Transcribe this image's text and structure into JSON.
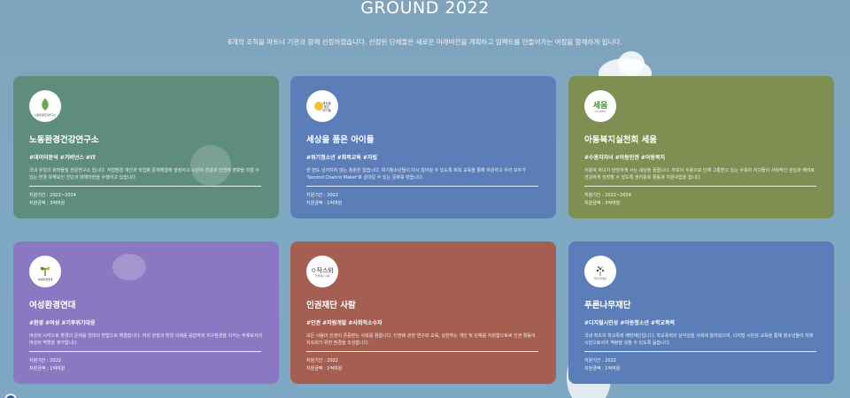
{
  "page": {
    "title": "GROUND 2022",
    "subtitle": "6개의 조직을 파트너 기관과 함께 선정하였습니다. 선정된 단체들은 새로운 미래비전을 계획하고 임팩트를 만들어가는 여정을 함께하게 됩니다."
  },
  "cards": [
    {
      "name": "노동환경건강연구소",
      "tags": "#데이터분석 #거버넌스 #IT",
      "desc": "국내 유일의 화학물질 전문연구소 입니다. 작업환경 개선과 직업병 문제해결에 앞장서고 시민의 건강과 안전에 영향을 미칠 수 있는 환경 유해요인 진단과 대책마련을 수행하고 있습니다.",
      "period": "지원기간 : 2022~2024",
      "amount": "지원금액 : 3억여원",
      "logo_text": "노동환경건강연구소",
      "bg": "#5f8d7b"
    },
    {
      "name": "세상을 품은 아이들",
      "tags": "#위기청소년 #회복교육 #자립",
      "desc": "한 번도 넘어지지 않는 청춘은 없습니다. 위기청소년들이 다시 일어설 수 있도록 회복 교육을 통해 자원하고 우리 모두가 'Second Chance Maker'로 살아갈 수 있는 문화를 만듭니다.",
      "period": "지원기간 : 2022",
      "amount": "지원금액 : 1억여원",
      "logo_text": "세상을 품은 아이들",
      "bg": "#5b7eb9"
    },
    {
      "name": "아동복지실천회 세움",
      "tags": "#수용자자녀 #아동인권 #아동복지",
      "desc": "수용자 자녀가 당당하게 사는 세상을 꿈꿉니다. 부모의 수용으로 인해 고통받고 있는 수용자 자녀들이 사회적인 관심과 배려로 건강하게 성장할 수 있도록 권리옹호 활동과 지원사업을 합니다.",
      "period": "지원기간 : 2022~2024",
      "amount": "지원금액 : 3억여원",
      "logo_text": "세움",
      "bg": "#7f8f52"
    },
    {
      "name": "여성환경연대",
      "tags": "#환경 #여성 #기후위기대응",
      "desc": "여성의 시각으로 환경의 문제를 연대의 방법으로 해결합니다. 여성 관점과 환경 의제를 융합하여 지구환경을 지키는 주체로서의 여성의 역할을 생각합니다.",
      "period": "지원기간 : 2022",
      "amount": "지원금액 : 1억여원",
      "logo_text": "여성환경연대",
      "bg": "#8a79c2"
    },
    {
      "name": "인권재단 사람",
      "tags": "#인권 #자원개발 #사회적소수자",
      "desc": "모든 사람이 인권이 존중받는 사회를 꿈꿉니다. 인권에 관한 연구와 교육, 실천하는 개인 및 단체를 지원함으로써 인권 활동이 지속되기 위한 환경을 조성합니다.",
      "period": "지원기간 : 2022",
      "amount": "지원금액 : 1억여원",
      "logo_text": "인권재단 사람",
      "bg": "#a55f51"
    },
    {
      "name": "푸른나무재단",
      "tags": "#디지털시민성 #아동청소년 #학교폭력",
      "desc": "국내 최초의 학교폭력 예방재단입니다. 학교폭력의 심각성을 사회에 알려왔으며, 디지털 시민성 교육을 통해 청소년들이 미래 시민으로서의 역량을 갖출 수 있도록 돕습니다.",
      "period": "지원기간 : 2022",
      "amount": "지원금액 : 1억여원",
      "logo_text": "푸른나무재단",
      "bg": "#5b7eb9"
    }
  ],
  "icons": {
    "card_0": "leaf-logo-icon",
    "card_1": "sun-logo-icon",
    "card_2": "seum-logo-icon",
    "card_3": "sprout-logo-icon",
    "card_4": "saram-logo-icon",
    "card_5": "tree-logo-icon"
  }
}
